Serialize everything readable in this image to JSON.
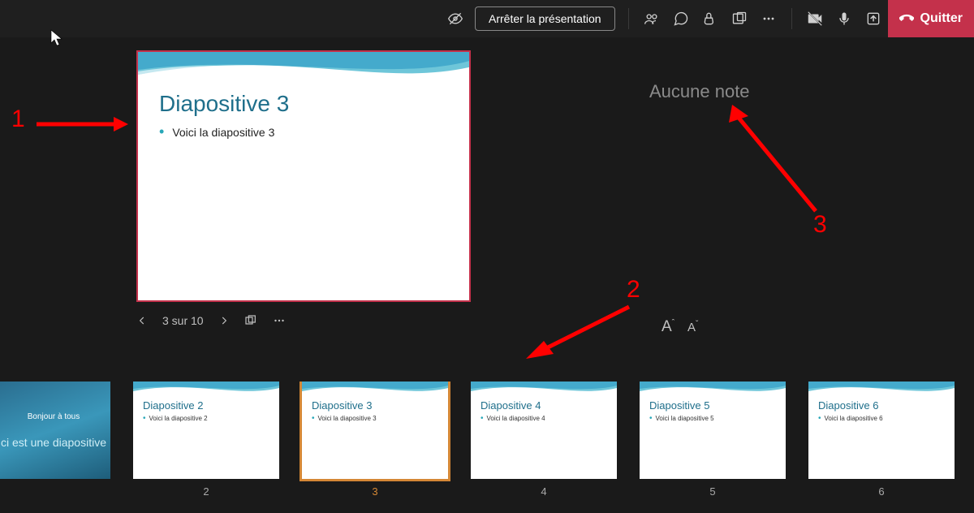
{
  "toolbar": {
    "stop_presentation": "Arrêter la présentation",
    "leave": "Quitter"
  },
  "main_slide": {
    "title": "Diapositive 3",
    "bullet": "Voici la diapositive 3"
  },
  "slide_counter": "3 sur 10",
  "notes_placeholder": "Aucune note",
  "font_increase": "A",
  "font_decrease": "A",
  "annotations": {
    "a1": "1",
    "a2": "2",
    "a3": "3"
  },
  "thumbnails": [
    {
      "kind": "title",
      "line1": "Bonjour à tous",
      "line2": "ci est une diapositive",
      "num": ""
    },
    {
      "kind": "content",
      "title": "Diapositive 2",
      "bullet": "Voici la diapositive 2",
      "num": "2"
    },
    {
      "kind": "content",
      "title": "Diapositive 3",
      "bullet": "Voici la diapositive 3",
      "num": "3",
      "selected": true
    },
    {
      "kind": "content",
      "title": "Diapositive 4",
      "bullet": "Voici la diapositive 4",
      "num": "4"
    },
    {
      "kind": "content",
      "title": "Diapositive 5",
      "bullet": "Voici la diapositive 5",
      "num": "5"
    },
    {
      "kind": "content",
      "title": "Diapositive 6",
      "bullet": "Voici la diapositive 6",
      "num": "6"
    }
  ]
}
